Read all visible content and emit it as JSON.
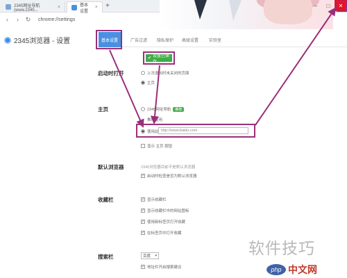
{
  "browser": {
    "tabs": [
      {
        "title": "2345网址导航(www.2345..."
      },
      {
        "title": "基本设置"
      }
    ],
    "address": "chrome://settings",
    "new_tab_symbol": "+"
  },
  "settings_header": {
    "brand": "2345浏览器 - 设置",
    "tabs": [
      {
        "label": "基本设置"
      },
      {
        "label": "广告过滤"
      },
      {
        "label": "隐私保护"
      },
      {
        "label": "高级设置"
      },
      {
        "label": "实验室"
      }
    ]
  },
  "save_tip": "设置已保存",
  "startup": {
    "label": "启动时打开",
    "options": [
      {
        "label": "上次退出时未关闭的页面",
        "selected": false
      },
      {
        "label": "主页",
        "selected": true
      }
    ]
  },
  "homepage": {
    "label": "主页",
    "nav_option": "2345网址导航",
    "nav_badge": "推荐",
    "nav_hint": "推荐使用",
    "custom_option": "使用此页",
    "custom_url": "http://www.baidu.com",
    "blank_option": "显示 主页 按钮",
    "selected": "custom"
  },
  "default_browser": {
    "label": "默认浏览器",
    "status": "2345浏览器目前不是默认浏览器",
    "check_option": "启动时检查是否为默认浏览器"
  },
  "bookmark_bar": {
    "label": "收藏栏",
    "options": [
      {
        "label": "显示收藏栏",
        "checked": true
      },
      {
        "label": "显示收藏栏中的网站图标",
        "checked": true
      },
      {
        "label": "使用新标签页打开收藏",
        "checked": true
      },
      {
        "label": "在标签页中打开收藏",
        "checked": true
      }
    ]
  },
  "search_bar": {
    "label": "搜索栏",
    "engine": "百度",
    "option": "地址栏开启搜索建议"
  },
  "watermark": {
    "text": "软件技巧",
    "logo_text": "php",
    "site_text": "中文网"
  },
  "colors": {
    "accent": "#4a90e2",
    "highlight": "#9a2f7a",
    "success": "#3fae48",
    "close": "#e81123"
  }
}
